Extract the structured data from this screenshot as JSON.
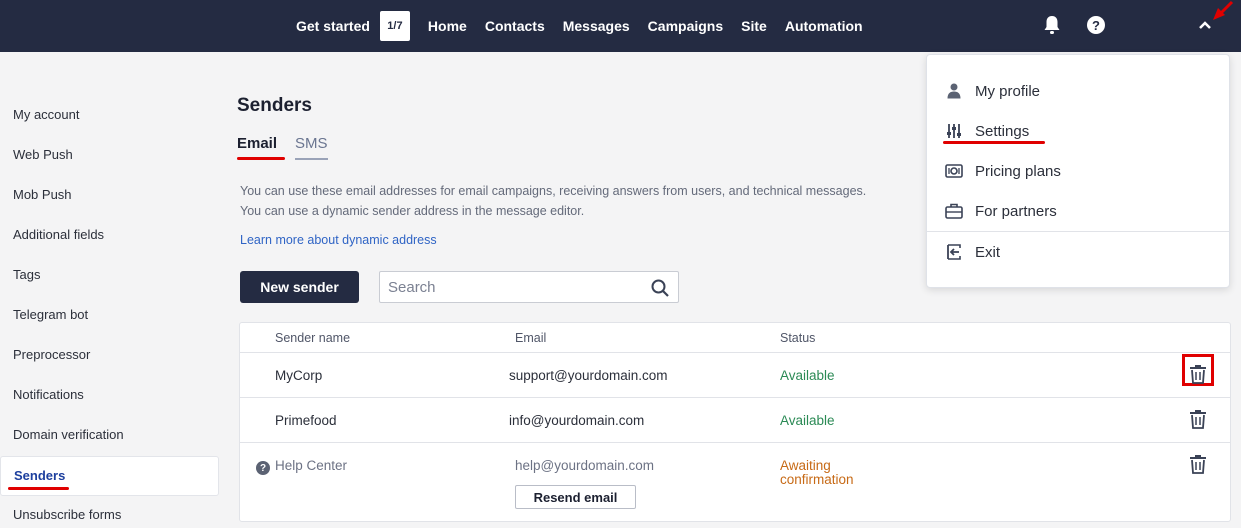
{
  "topbar": {
    "nav": {
      "get_started": "Get started",
      "step_badge": "1/7",
      "home": "Home",
      "contacts": "Contacts",
      "messages": "Messages",
      "campaigns": "Campaigns",
      "site": "Site",
      "automation": "Automation"
    },
    "icons": [
      "bell-icon",
      "help-icon",
      "chevron-up-icon"
    ],
    "help_glyph": "?"
  },
  "sidebar": {
    "items": [
      {
        "label": "My account"
      },
      {
        "label": "Web Push"
      },
      {
        "label": "Mob Push"
      },
      {
        "label": "Additional fields"
      },
      {
        "label": "Tags"
      },
      {
        "label": "Telegram bot"
      },
      {
        "label": "Preprocessor"
      },
      {
        "label": "Notifications"
      },
      {
        "label": "Domain verification"
      },
      {
        "label": "Senders"
      },
      {
        "label": "Unsubscribe forms"
      }
    ],
    "active_index": 9
  },
  "main": {
    "title": "Senders",
    "tabs": [
      {
        "label": "Email",
        "active": true
      },
      {
        "label": "SMS",
        "active": false
      }
    ],
    "description_line1": "You can use these email addresses for email campaigns, receiving answers from users, and technical messages.",
    "description_line2": "You can use a dynamic sender address in the message editor.",
    "learn_more": "Learn more about dynamic address",
    "new_sender_label": "New sender",
    "search_placeholder": "Search"
  },
  "table": {
    "headers": {
      "name": "Sender name",
      "email": "Email",
      "status": "Status"
    },
    "rows": [
      {
        "name": "MyCorp",
        "email": "support@yourdomain.com",
        "status": "Available"
      },
      {
        "name": "Primefood",
        "email": "info@yourdomain.com",
        "status": "Available"
      },
      {
        "name": "Help Center",
        "email": "help@yourdomain.com",
        "status_line1": "Awaiting",
        "status_line2": "confirmation",
        "resend_label": "Resend email"
      }
    ]
  },
  "dropdown": {
    "items": [
      {
        "label": "My profile",
        "icon": "user-icon"
      },
      {
        "label": "Settings",
        "icon": "sliders-icon"
      },
      {
        "label": "Pricing plans",
        "icon": "money-icon"
      },
      {
        "label": "For partners",
        "icon": "briefcase-icon"
      },
      {
        "label": "Exit",
        "icon": "exit-icon"
      }
    ]
  },
  "colors": {
    "topbar": "#242b42",
    "accent_link": "#2f64c5",
    "available": "#2b8a55",
    "awaiting": "#c76a16",
    "highlight": "#e00000"
  }
}
